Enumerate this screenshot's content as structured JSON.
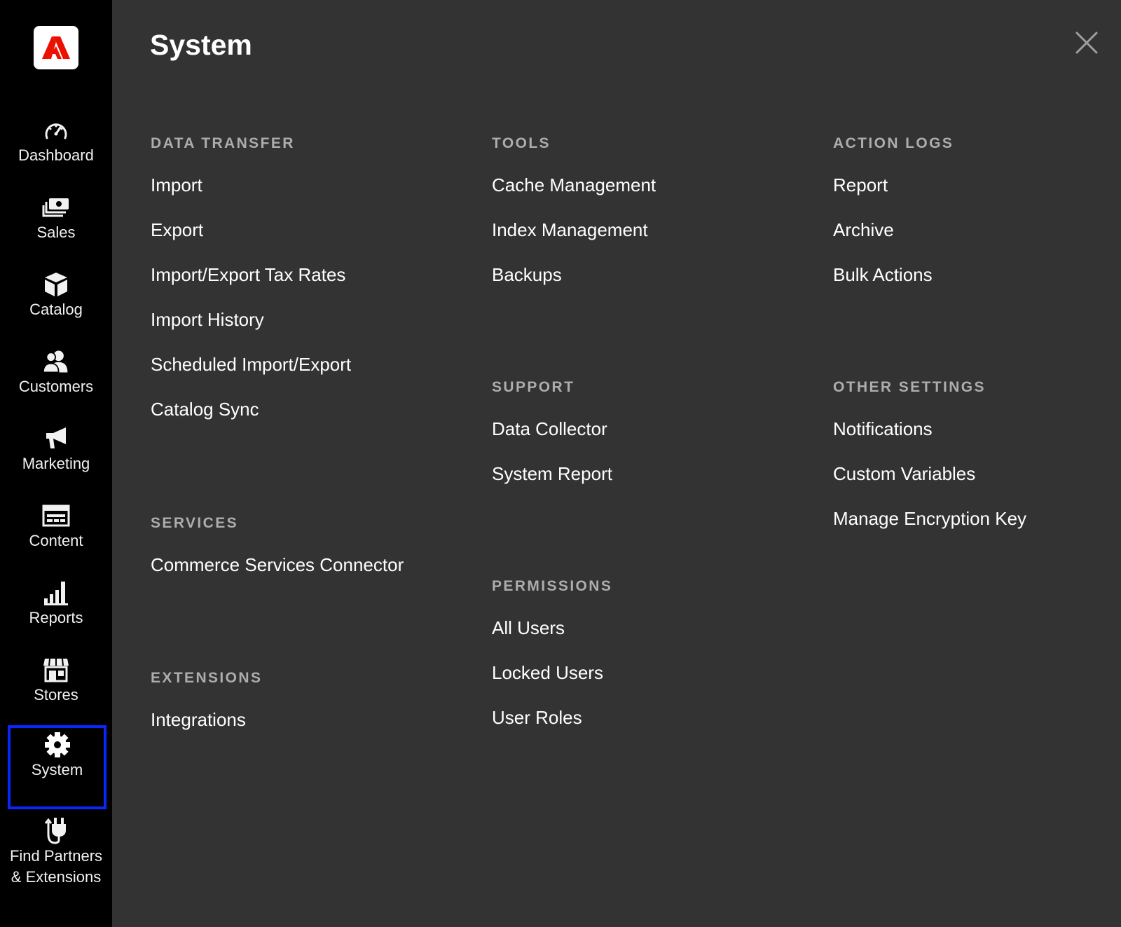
{
  "sidebar": {
    "logo_icon": "adobe-logo",
    "brand_color": "#eb1000",
    "active_outline_color": "#0a26ff",
    "items": [
      {
        "label": "Dashboard",
        "icon": "dashboard-gauge-icon"
      },
      {
        "label": "Sales",
        "icon": "sales-money-icon"
      },
      {
        "label": "Catalog",
        "icon": "catalog-box-icon"
      },
      {
        "label": "Customers",
        "icon": "customers-people-icon"
      },
      {
        "label": "Marketing",
        "icon": "marketing-megaphone-icon"
      },
      {
        "label": "Content",
        "icon": "content-layout-icon"
      },
      {
        "label": "Reports",
        "icon": "reports-bar-chart-icon"
      },
      {
        "label": "Stores",
        "icon": "stores-storefront-icon"
      },
      {
        "label": "System",
        "icon": "system-gear-icon",
        "active": true
      },
      {
        "label": "Find Partners & Extensions",
        "icon": "plug-icon"
      }
    ]
  },
  "panel": {
    "title": "System",
    "close_icon": "close-icon",
    "sections": {
      "data_transfer": {
        "heading": "DATA TRANSFER",
        "links": [
          "Import",
          "Export",
          "Import/Export Tax Rates",
          "Import History",
          "Scheduled Import/Export",
          "Catalog Sync"
        ]
      },
      "services": {
        "heading": "SERVICES",
        "links": [
          "Commerce Services Connector"
        ]
      },
      "extensions": {
        "heading": "EXTENSIONS",
        "links": [
          "Integrations"
        ]
      },
      "tools": {
        "heading": "TOOLS",
        "links": [
          "Cache Management",
          "Index Management",
          "Backups"
        ]
      },
      "support": {
        "heading": "SUPPORT",
        "links": [
          "Data Collector",
          "System Report"
        ]
      },
      "permissions": {
        "heading": "PERMISSIONS",
        "links": [
          "All Users",
          "Locked Users",
          "User Roles"
        ]
      },
      "action_logs": {
        "heading": "ACTION LOGS",
        "links": [
          "Report",
          "Archive",
          "Bulk Actions"
        ]
      },
      "other_settings": {
        "heading": "OTHER SETTINGS",
        "links": [
          "Notifications",
          "Custom Variables",
          "Manage Encryption Key"
        ]
      }
    }
  }
}
